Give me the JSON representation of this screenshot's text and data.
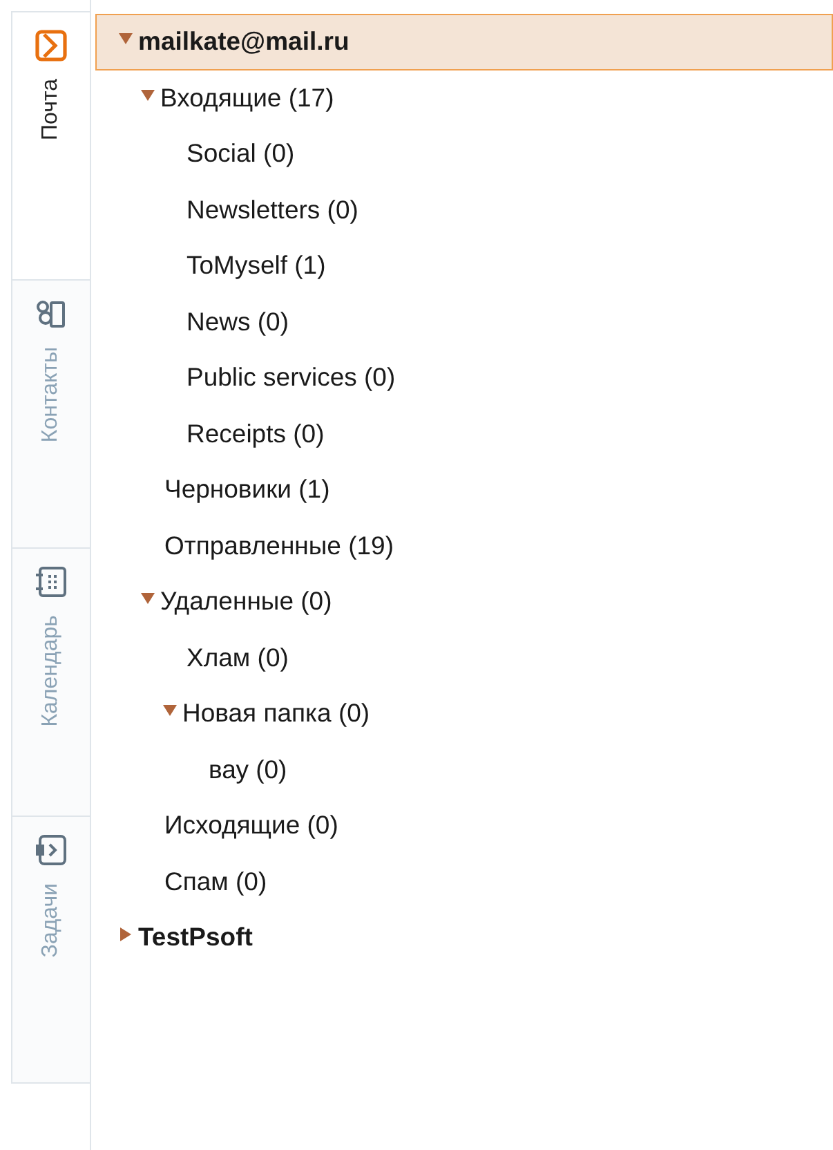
{
  "tabs": [
    {
      "label": "Почта",
      "selected": true
    },
    {
      "label": "Контакты",
      "selected": false
    },
    {
      "label": "Календарь",
      "selected": false
    },
    {
      "label": "Задачи",
      "selected": false
    }
  ],
  "tree": [
    {
      "label": "mailkate@mail.ru",
      "kind": "account",
      "selected": true,
      "expanded": true,
      "children": [
        {
          "label": "Входящие (17)",
          "selected": false,
          "expanded": true,
          "children": [
            {
              "label": "Social (0)",
              "selected": false
            },
            {
              "label": "Newsletters (0)",
              "selected": false
            },
            {
              "label": "ToMyself (1)",
              "selected": false
            },
            {
              "label": "News (0)",
              "selected": false
            },
            {
              "label": "Public services (0)",
              "selected": false
            },
            {
              "label": "Receipts (0)",
              "selected": false
            }
          ]
        },
        {
          "label": "Черновики (1)",
          "selected": false
        },
        {
          "label": "Отправленные (19)",
          "selected": false
        },
        {
          "label": "Удаленные (0)",
          "selected": false,
          "expanded": true,
          "children": [
            {
              "label": "Хлам (0)",
              "selected": false
            },
            {
              "label": "Новая папка (0)",
              "selected": false,
              "expanded": true,
              "children": [
                {
                  "label": "вау (0)",
                  "selected": false
                }
              ]
            }
          ]
        },
        {
          "label": "Исходящие (0)",
          "selected": false
        },
        {
          "label": "Спам (0)",
          "selected": false
        }
      ]
    },
    {
      "label": "TestPsoft",
      "kind": "account",
      "selected": false,
      "expanded": false
    }
  ]
}
